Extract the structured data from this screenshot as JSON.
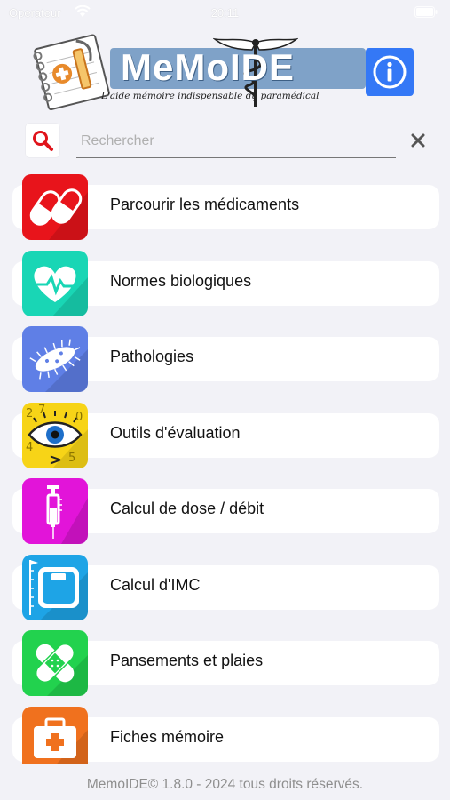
{
  "status_bar": {
    "carrier": "Operateur",
    "time": "20:11"
  },
  "header": {
    "logo_text": "MeMoIDE",
    "tagline": "L'aide mémoire indispensable du paramédical"
  },
  "search": {
    "placeholder": "Rechercher",
    "value": ""
  },
  "menu": {
    "items": [
      {
        "label": "Parcourir les médicaments",
        "icon": "pills-icon",
        "color": "#e8141b"
      },
      {
        "label": "Normes biologiques",
        "icon": "heart-pulse-icon",
        "color": "#19d6b5"
      },
      {
        "label": "Pathologies",
        "icon": "bacteria-icon",
        "color": "#5f7fe6"
      },
      {
        "label": "Outils d'évaluation",
        "icon": "eye-chart-icon",
        "color": "#f7d417"
      },
      {
        "label": "Calcul de dose / débit",
        "icon": "syringe-icon",
        "color": "#e214d9"
      },
      {
        "label": "Calcul d'IMC",
        "icon": "scale-icon",
        "color": "#1ea4e6"
      },
      {
        "label": "Pansements et plaies",
        "icon": "bandage-icon",
        "color": "#22d24e"
      },
      {
        "label": "Fiches mémoire",
        "icon": "first-aid-kit-icon",
        "color": "#f0711e"
      }
    ]
  },
  "footer": {
    "text": "MemoIDE© 1.8.0 - 2024 tous droits réservés."
  }
}
